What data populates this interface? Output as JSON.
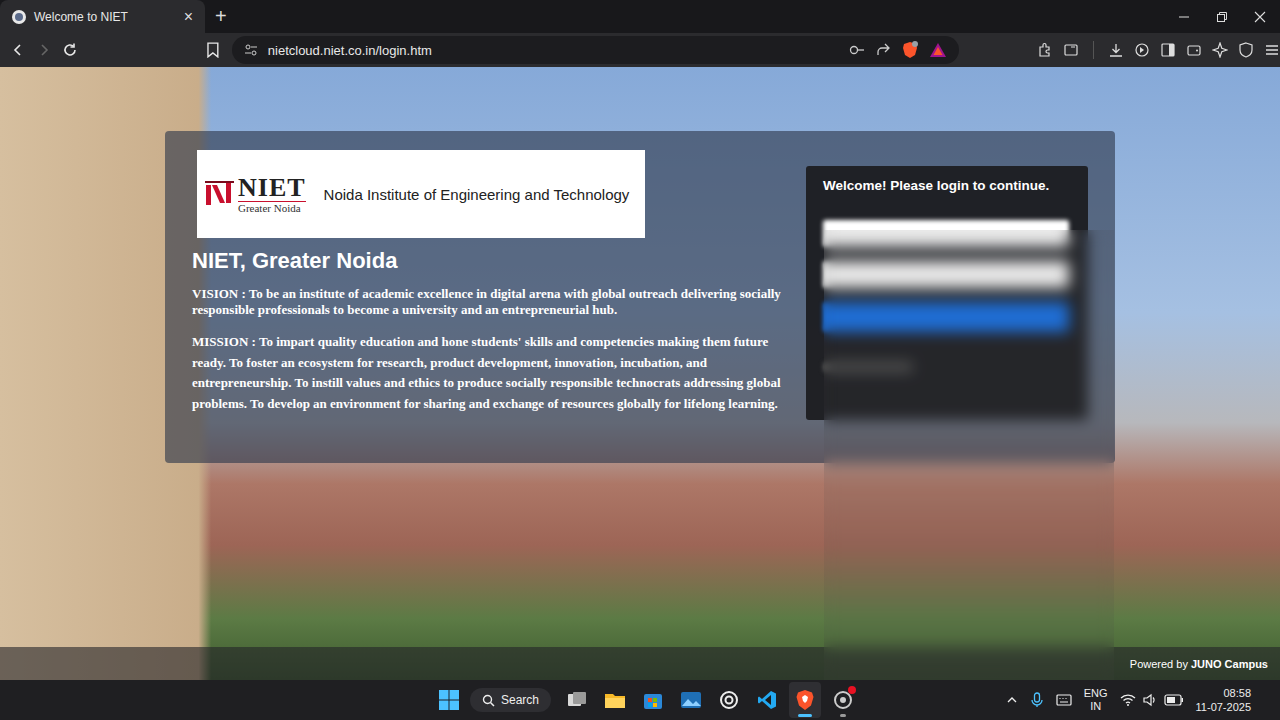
{
  "browser": {
    "tab": {
      "title": "Welcome to NIET",
      "close": "×",
      "selected": true
    },
    "new_tab": "+",
    "address": "nietcloud.niet.co.in/login.htm",
    "forward_disabled": true
  },
  "page": {
    "logo": {
      "mark": "NIET",
      "sub": "Greater Noida",
      "name": "Noida Institute of Engineering and Technology"
    },
    "heading": "NIET, Greater Noida",
    "paragraphs": [
      {
        "label": "VISION :",
        "text": "To be an institute of academic excellence in digital arena with global outreach delivering socially responsible professionals to become a university and an entrepreneurial hub."
      },
      {
        "label": "MISSION :",
        "text": "To impart quality education and hone students' skills and competencies making them future ready. To foster an ecosystem for research, product development, innovation, incubation, and entrepreneurship. To instill values and ethics to produce socially responsible technocrats addressing global problems. To develop an environment for sharing and exchange of resources globally for lifelong learning."
      }
    ],
    "login": {
      "title": "Welcome! Please login to continue.",
      "fields": [
        {
          "kind": "input"
        },
        {
          "kind": "input"
        },
        {
          "kind": "button"
        },
        {
          "kind": "link"
        }
      ]
    },
    "footer": {
      "prefix": "Powered by",
      "brand": "JUNO Campus"
    }
  },
  "taskbar": {
    "search": "Search",
    "apps": [
      {
        "kind": "taskview",
        "running": false,
        "active": false,
        "badge": false
      },
      {
        "kind": "explorer",
        "running": false,
        "active": false,
        "badge": false
      },
      {
        "kind": "store",
        "running": false,
        "active": false,
        "badge": false
      },
      {
        "kind": "photos",
        "running": false,
        "active": false,
        "badge": false
      },
      {
        "kind": "chatgpt",
        "running": false,
        "active": false,
        "badge": false
      },
      {
        "kind": "vscode",
        "running": false,
        "active": false,
        "badge": false
      },
      {
        "kind": "brave",
        "running": true,
        "active": true,
        "badge": false
      },
      {
        "kind": "recorder",
        "running": true,
        "active": false,
        "badge": true
      }
    ],
    "language": [
      "ENG",
      "IN"
    ],
    "time": "08:58",
    "date": "11-07-2025"
  }
}
